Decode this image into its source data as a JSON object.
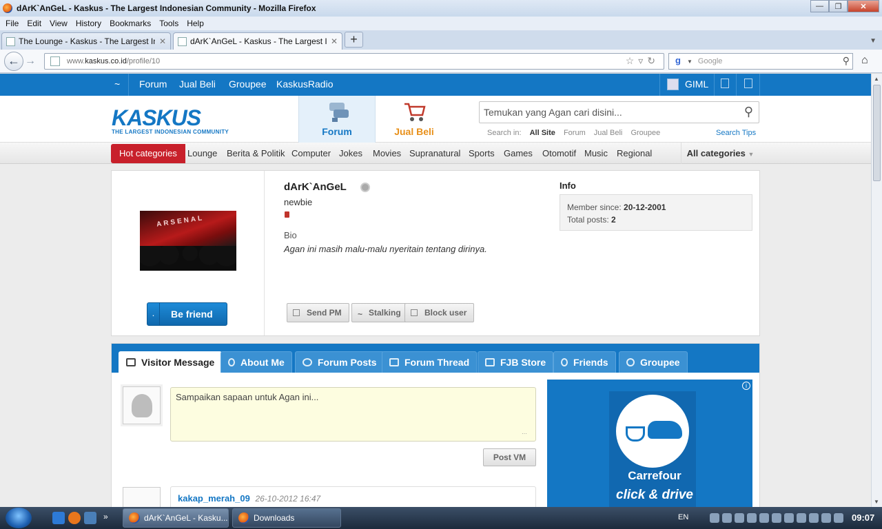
{
  "browser": {
    "window_title": "dArK`AnGeL - Kaskus - The Largest Indonesian Community - Mozilla Firefox",
    "menu": [
      "File",
      "Edit",
      "View",
      "History",
      "Bookmarks",
      "Tools",
      "Help"
    ],
    "tabs": [
      {
        "label": "The Lounge - Kaskus - The Largest Indon...",
        "active": false
      },
      {
        "label": "dArK`AnGeL - Kaskus - The Largest Indo...",
        "active": true
      }
    ],
    "new_tab": "+",
    "url_prefix": "www.",
    "url_domain": "kaskus.co.id",
    "url_path": "/profile/10",
    "search_placeholder": "Google",
    "search_engine_icon": "google-icon"
  },
  "site": {
    "top_nav": [
      "Forum",
      "Jual Beli",
      "Groupee",
      "KaskusRadio"
    ],
    "top_nav_tilde": "~",
    "user_short": "GIML",
    "logo_word": "KASKUS",
    "logo_tagline": "THE LARGEST INDONESIAN COMMUNITY",
    "header_tabs": [
      {
        "label": "Forum",
        "icon": "forum-icon"
      },
      {
        "label": "Jual Beli",
        "icon": "cart-icon"
      }
    ],
    "search_placeholder": "Temukan yang Agan cari disini...",
    "search_in_label": "Search in:",
    "search_in_options": [
      "All Site",
      "Forum",
      "Jual Beli",
      "Groupee"
    ],
    "search_tips": "Search Tips",
    "hot_categories": "Hot categories",
    "categories": [
      "Lounge",
      "Berita & Politik",
      "Computer",
      "Jokes",
      "Movies",
      "Supranatural",
      "Sports",
      "Games",
      "Otomotif",
      "Music",
      "Regional"
    ],
    "all_categories": "All categories"
  },
  "profile": {
    "username": "dArK`AnGeL",
    "rank": "newbie",
    "bio_heading": "Bio",
    "bio": "Agan ini masih malu-malu nyeritain tentang dirinya.",
    "info_heading": "Info",
    "member_since_label": "Member since:",
    "member_since": "20-12-2001",
    "total_posts_label": "Total posts:",
    "total_posts": "2",
    "photo_text": "ARSENAL",
    "be_friend": "Be friend",
    "actions": [
      "Send PM",
      "Stalking",
      "Block user"
    ]
  },
  "profile_tabs": [
    "Visitor Message",
    "About Me",
    "Forum Posts",
    "Forum Thread",
    "FJB Store",
    "Friends",
    "Groupee"
  ],
  "visitor_message": {
    "placeholder": "Sampaikan sapaan untuk Agan ini...",
    "post_button": "Post VM",
    "first_message": {
      "user": "kakap_merah_09",
      "time": "26-10-2012 16:47"
    }
  },
  "ad": {
    "brand": "Carrefour",
    "sub": "click & drive",
    "info": "i"
  },
  "taskbar": {
    "tasks": [
      {
        "label": "dArK`AnGeL - Kasku...",
        "active": true
      },
      {
        "label": "Downloads",
        "active": false
      }
    ],
    "language": "EN",
    "time": "09:07"
  },
  "colors": {
    "kaskus_blue": "#1477c4",
    "hot_red": "#c8202b",
    "jual_beli_orange": "#e8901a"
  }
}
